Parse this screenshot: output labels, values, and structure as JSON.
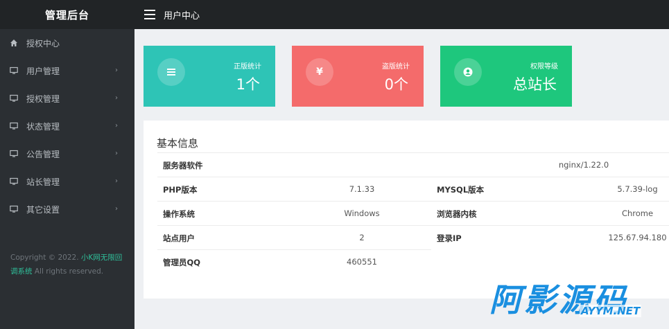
{
  "app": {
    "brand": "管理后台",
    "page_title": "用户中心"
  },
  "sidebar": {
    "items": [
      {
        "label": "授权中心",
        "icon": "home-icon",
        "has_submenu": false
      },
      {
        "label": "用户管理",
        "icon": "monitor-icon",
        "has_submenu": true
      },
      {
        "label": "授权管理",
        "icon": "monitor-icon",
        "has_submenu": true
      },
      {
        "label": "状态管理",
        "icon": "monitor-icon",
        "has_submenu": true
      },
      {
        "label": "公告管理",
        "icon": "monitor-icon",
        "has_submenu": true
      },
      {
        "label": "站长管理",
        "icon": "monitor-icon",
        "has_submenu": true
      },
      {
        "label": "其它设置",
        "icon": "monitor-icon",
        "has_submenu": true
      }
    ],
    "copyright": {
      "prefix": "Copyright © 2022. ",
      "link": "小K网无限回调系统",
      "suffix": " All rights reserved."
    }
  },
  "cards": [
    {
      "label": "正版统计",
      "value": "1个",
      "icon": "list-icon",
      "icon_glyph": "≣",
      "color": "#2ec4b6"
    },
    {
      "label": "盗版统计",
      "value": "0个",
      "icon": "yen-icon",
      "icon_glyph": "¥",
      "color": "#f46b6b"
    },
    {
      "label": "权限等级",
      "value": "总站长",
      "icon": "user-circle-icon",
      "icon_glyph": "",
      "color": "#1ec77d"
    }
  ],
  "basic_info": {
    "title": "基本信息",
    "server_software_label": "服务器软件",
    "server_software_value": "nginx/1.22.0",
    "php_label": "PHP版本",
    "php_value": "7.1.33",
    "mysql_label": "MYSQL版本",
    "mysql_value": "5.7.39-log",
    "os_label": "操作系统",
    "os_value": "Windows",
    "browser_label": "浏览器内核",
    "browser_value": "Chrome",
    "site_users_label": "站点用户",
    "site_users_value": "2",
    "login_ip_label": "登录IP",
    "login_ip_value": "125.67.94.180",
    "admin_qq_label": "管理员QQ",
    "admin_qq_value": "460551"
  },
  "watermark": {
    "cn": "阿影源码",
    "en": "AYYM.NET"
  }
}
